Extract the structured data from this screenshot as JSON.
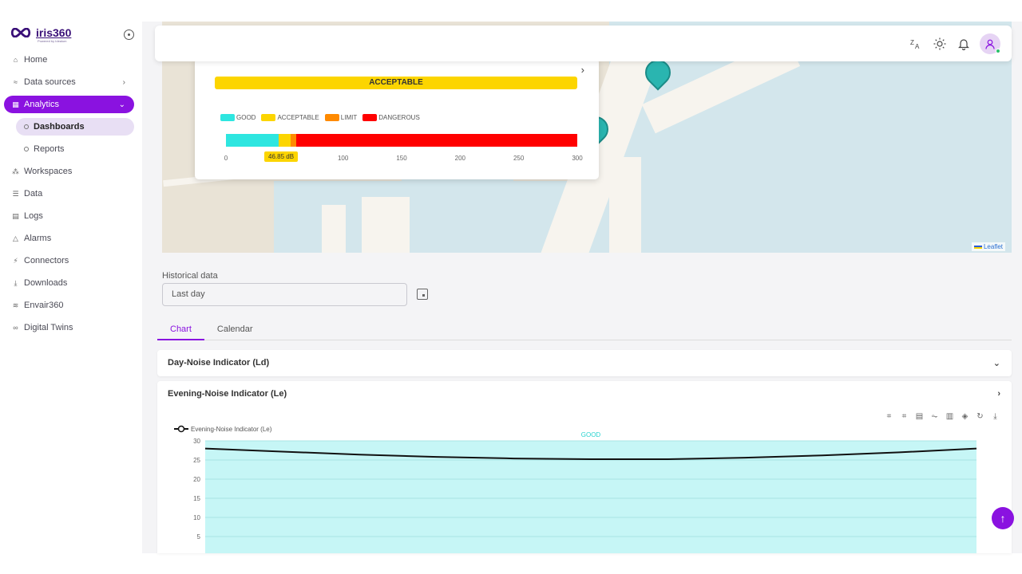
{
  "brand": {
    "name": "iris360",
    "tagline": "Powered by Idealum"
  },
  "sidebar": {
    "items": [
      {
        "label": "Home",
        "icon": "home-icon"
      },
      {
        "label": "Data sources",
        "icon": "wifi-icon"
      },
      {
        "label": "Analytics",
        "icon": "grid-icon"
      },
      {
        "label": "Dashboards",
        "icon": "circle-icon"
      },
      {
        "label": "Reports",
        "icon": "circle-icon"
      },
      {
        "label": "Workspaces",
        "icon": "workspace-icon"
      },
      {
        "label": "Data",
        "icon": "database-icon"
      },
      {
        "label": "Logs",
        "icon": "file-icon"
      },
      {
        "label": "Alarms",
        "icon": "alarm-icon"
      },
      {
        "label": "Connectors",
        "icon": "plug-icon"
      },
      {
        "label": "Downloads",
        "icon": "download-icon"
      },
      {
        "label": "Envair360",
        "icon": "air-icon"
      },
      {
        "label": "Digital Twins",
        "icon": "twin-icon"
      }
    ]
  },
  "header": {
    "icons": [
      "translate-icon",
      "sun-icon",
      "bell-icon",
      "user-icon"
    ]
  },
  "map": {
    "attribution": "Leaflet",
    "popup": {
      "status": "ACCEPTABLE",
      "legend": [
        {
          "label": "GOOD",
          "color": "#2ee6e0"
        },
        {
          "label": "ACCEPTABLE",
          "color": "#fcd500"
        },
        {
          "label": "LIMIT",
          "color": "#ff8a00"
        },
        {
          "label": "DANGEROUS",
          "color": "#ff0000"
        }
      ],
      "scale_ticks": [
        "0",
        "100",
        "150",
        "200",
        "250",
        "300"
      ],
      "scale_max": 300,
      "thresholds": [
        45,
        55,
        60,
        300
      ],
      "value_label": "46.85 dB",
      "value": 46.85
    }
  },
  "historical": {
    "label": "Historical data",
    "value": "Last day"
  },
  "tabs": [
    {
      "label": "Chart"
    },
    {
      "label": "Calendar"
    }
  ],
  "accordions": [
    {
      "title": "Day-Noise Indicator (Ld)"
    },
    {
      "title": "Evening-Noise Indicator (Le)"
    }
  ],
  "chart_data": {
    "type": "area",
    "series": [
      {
        "name": "Evening-Noise Indicator (Le)",
        "values": [
          28,
          27.2,
          26.4,
          25.8,
          25.4,
          25.2,
          25.2,
          25.6,
          26.2,
          27,
          28
        ]
      }
    ],
    "y_ticks": [
      "30",
      "25",
      "20",
      "15",
      "10",
      "5"
    ],
    "ylim": [
      0,
      30
    ],
    "band_label": "GOOD",
    "band_color": "#c6f6f6",
    "line_color": "#111111"
  }
}
